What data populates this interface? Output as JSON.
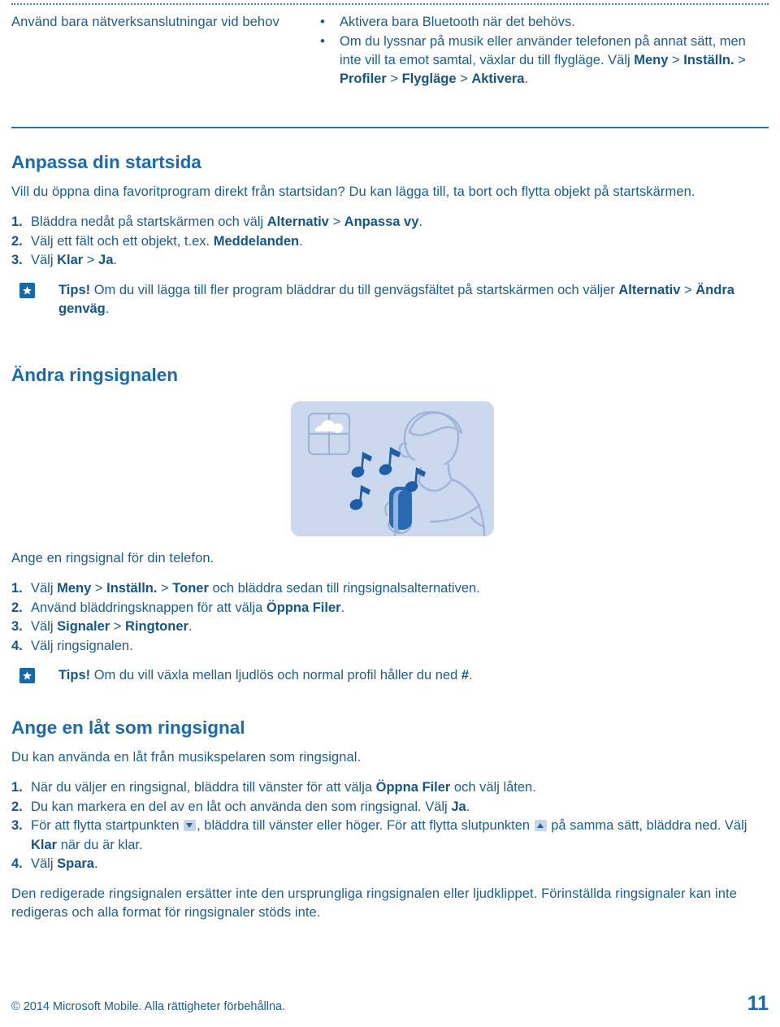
{
  "document": {
    "language": "sv",
    "accent_color": "#1a6ab0",
    "body_color": "#1b5e8e",
    "rule_color": "#2f6fa4"
  },
  "intro_table": {
    "left_cell": "Använd bara nätverksanslutningar vid behov",
    "bullets": [
      {
        "parts": [
          {
            "text": "Aktivera bara Bluetooth när det behövs.",
            "bold": false
          }
        ]
      },
      {
        "parts": [
          {
            "text": "Om du lyssnar på musik eller använder telefonen på annat sätt, men inte vill ta emot samtal, växlar du till flygläge. Välj ",
            "bold": false
          },
          {
            "text": "Meny",
            "bold": true
          },
          {
            "text": " > ",
            "bold": false
          },
          {
            "text": "Inställn.",
            "bold": true
          },
          {
            "text": " > ",
            "bold": false
          },
          {
            "text": "Profiler",
            "bold": true
          },
          {
            "text": " > ",
            "bold": false
          },
          {
            "text": "Flygläge",
            "bold": true
          },
          {
            "text": " > ",
            "bold": false
          },
          {
            "text": "Aktivera",
            "bold": true
          },
          {
            "text": ".",
            "bold": false
          }
        ]
      }
    ]
  },
  "section_startsida": {
    "title": "Anpassa din startsida",
    "intro": "Vill du öppna dina favoritprogram direkt från startsidan? Du kan lägga till, ta bort och flytta objekt på startskärmen.",
    "steps": [
      {
        "number": "1.",
        "parts": [
          {
            "text": "Bläddra nedåt på startskärmen och välj ",
            "bold": false
          },
          {
            "text": "Alternativ",
            "bold": true
          },
          {
            "text": " > ",
            "bold": false
          },
          {
            "text": "Anpassa vy",
            "bold": true
          },
          {
            "text": ".",
            "bold": false
          }
        ]
      },
      {
        "number": "2.",
        "parts": [
          {
            "text": "Välj ett fält och ett objekt, t.ex. ",
            "bold": false
          },
          {
            "text": "Meddelanden",
            "bold": true
          },
          {
            "text": ".",
            "bold": false
          }
        ]
      },
      {
        "number": "3.",
        "parts": [
          {
            "text": "Välj ",
            "bold": false
          },
          {
            "text": "Klar",
            "bold": true
          },
          {
            "text": " > ",
            "bold": false
          },
          {
            "text": "Ja",
            "bold": true
          },
          {
            "text": ".",
            "bold": false
          }
        ]
      }
    ],
    "tip": {
      "icon": "star-tip-icon",
      "parts": [
        {
          "text": "Tips!",
          "bold": true
        },
        {
          "text": " Om du vill lägga till fler program bläddrar du till genvägsfältet på startskärmen och väljer ",
          "bold": false
        },
        {
          "text": "Alternativ",
          "bold": true
        },
        {
          "text": " > ",
          "bold": false
        },
        {
          "text": "Ändra genväg",
          "bold": true
        },
        {
          "text": ".",
          "bold": false
        }
      ]
    }
  },
  "section_ringsignal": {
    "title": "Ändra ringsignalen",
    "illustration": {
      "name": "person-listening-to-music-illustration",
      "background_color": "#ccd8ee",
      "outline_color": "#9fb4d8",
      "note_color": "#1c5fa8",
      "elements": [
        "window-with-clouds",
        "person-holding-phone",
        "music-notes"
      ]
    },
    "intro": "Ange en ringsignal för din telefon.",
    "steps": [
      {
        "number": "1.",
        "parts": [
          {
            "text": "Välj ",
            "bold": false
          },
          {
            "text": "Meny",
            "bold": true
          },
          {
            "text": " > ",
            "bold": false
          },
          {
            "text": "Inställn.",
            "bold": true
          },
          {
            "text": " > ",
            "bold": false
          },
          {
            "text": "Toner",
            "bold": true
          },
          {
            "text": " och bläddra sedan till ringsignalsalternativen.",
            "bold": false
          }
        ]
      },
      {
        "number": "2.",
        "parts": [
          {
            "text": "Använd bläddringsknappen för att välja ",
            "bold": false
          },
          {
            "text": "Öppna Filer",
            "bold": true
          },
          {
            "text": ".",
            "bold": false
          }
        ]
      },
      {
        "number": "3.",
        "parts": [
          {
            "text": "Välj ",
            "bold": false
          },
          {
            "text": "Signaler",
            "bold": true
          },
          {
            "text": " > ",
            "bold": false
          },
          {
            "text": "Ringtoner",
            "bold": true
          },
          {
            "text": ".",
            "bold": false
          }
        ]
      },
      {
        "number": "4.",
        "parts": [
          {
            "text": "Välj ringsignalen.",
            "bold": false
          }
        ]
      }
    ],
    "tip": {
      "icon": "star-tip-icon",
      "parts": [
        {
          "text": "Tips!",
          "bold": true
        },
        {
          "text": " Om du vill växla mellan ljudlös och normal profil håller du ned ",
          "bold": false
        },
        {
          "text": "#",
          "bold": true
        },
        {
          "text": ".",
          "bold": false
        }
      ]
    }
  },
  "section_lat": {
    "title": "Ange en låt som ringsignal",
    "intro": "Du kan använda en låt från musikspelaren som ringsignal.",
    "steps": [
      {
        "number": "1.",
        "parts": [
          {
            "text": "När du väljer en ringsignal, bläddra till vänster för att välja ",
            "bold": false
          },
          {
            "text": "Öppna Filer",
            "bold": true
          },
          {
            "text": " och välj låten.",
            "bold": false
          }
        ]
      },
      {
        "number": "2.",
        "parts": [
          {
            "text": "Du kan markera en del av en låt och använda den som ringsignal. Välj ",
            "bold": false
          },
          {
            "text": "Ja",
            "bold": true
          },
          {
            "text": ".",
            "bold": false
          }
        ]
      },
      {
        "number": "3.",
        "parts": [
          {
            "text": "För att flytta startpunkten ",
            "bold": false
          },
          {
            "icon": "arrow-down-badge-icon"
          },
          {
            "text": ", bläddra till vänster eller höger. För att flytta slutpunkten ",
            "bold": false
          },
          {
            "icon": "arrow-up-badge-icon"
          },
          {
            "text": " på samma sätt, bläddra ned. Välj ",
            "bold": false
          },
          {
            "text": "Klar",
            "bold": true
          },
          {
            "text": " när du är klar.",
            "bold": false
          }
        ]
      },
      {
        "number": "4.",
        "parts": [
          {
            "text": "Välj ",
            "bold": false
          },
          {
            "text": "Spara",
            "bold": true
          },
          {
            "text": ".",
            "bold": false
          }
        ]
      }
    ],
    "note": "Den redigerade ringsignalen ersätter inte den ursprungliga ringsignalen eller ljudklippet. Förinställda ringsignaler kan inte redigeras och alla format för ringsignaler stöds inte."
  },
  "footer": {
    "copyright": "© 2014 Microsoft Mobile. Alla rättigheter förbehållna.",
    "page_number": "11"
  }
}
